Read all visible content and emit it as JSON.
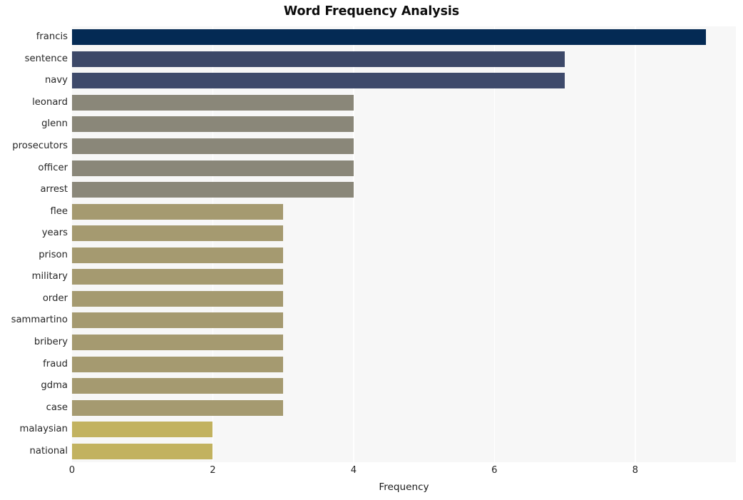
{
  "chart_data": {
    "type": "bar",
    "orientation": "horizontal",
    "title": "Word Frequency Analysis",
    "xlabel": "Frequency",
    "ylabel": "",
    "categories": [
      "francis",
      "sentence",
      "navy",
      "leonard",
      "glenn",
      "prosecutors",
      "officer",
      "arrest",
      "flee",
      "years",
      "prison",
      "military",
      "order",
      "sammartino",
      "bribery",
      "fraud",
      "gdma",
      "case",
      "malaysian",
      "national"
    ],
    "values": [
      9,
      7,
      7,
      4,
      4,
      4,
      4,
      4,
      3,
      3,
      3,
      3,
      3,
      3,
      3,
      3,
      3,
      3,
      2,
      2
    ],
    "bar_colors": [
      "#042a54",
      "#3c4868",
      "#3e4a6b",
      "#8a8779",
      "#8a8779",
      "#8a8779",
      "#8a8779",
      "#8a8779",
      "#a59a70",
      "#a59a70",
      "#a59a70",
      "#a59a70",
      "#a59a70",
      "#a59a70",
      "#a59a70",
      "#a59a70",
      "#a59a70",
      "#a59a70",
      "#c2b25f",
      "#c2b25f"
    ],
    "xlim": [
      0,
      9.43
    ],
    "xticks": [
      0,
      2,
      4,
      6,
      8
    ],
    "xticklabels": [
      "0",
      "2",
      "4",
      "6",
      "8"
    ],
    "grid": true,
    "gridlines_at": [
      2,
      4,
      6,
      8
    ],
    "legend": null,
    "plot_background": "#f7f7f7",
    "grid_color": "#ffffff",
    "figure_background": "#ffffff"
  }
}
